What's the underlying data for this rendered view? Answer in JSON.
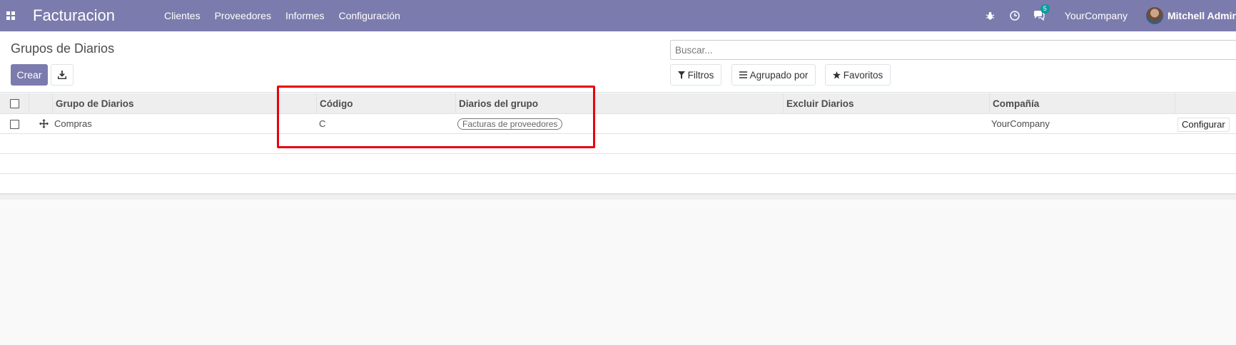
{
  "navbar": {
    "app_name": "Facturacion",
    "menu": [
      "Clientes",
      "Proveedores",
      "Informes",
      "Configuración"
    ],
    "chat_count": "5",
    "company": "YourCompany",
    "user": "Mitchell Admin (c"
  },
  "control_panel": {
    "title": "Grupos de Diarios",
    "create_label": "Crear",
    "search_placeholder": "Buscar...",
    "filters_label": "Filtros",
    "groupby_label": "Agrupado por",
    "favorites_label": "Favoritos"
  },
  "table": {
    "columns": [
      "Grupo de Diarios",
      "Código",
      "Diarios del grupo",
      "Excluir Diarios",
      "Compañía"
    ],
    "rows": [
      {
        "name": "Compras",
        "code": "C",
        "journals_tag": "Facturas de proveedores",
        "exclude": "",
        "company": "YourCompany",
        "action_label": "Configurar"
      }
    ]
  },
  "colors": {
    "primary": "#7c7bad",
    "highlight": "#e8000b",
    "badge": "#00a09d"
  }
}
